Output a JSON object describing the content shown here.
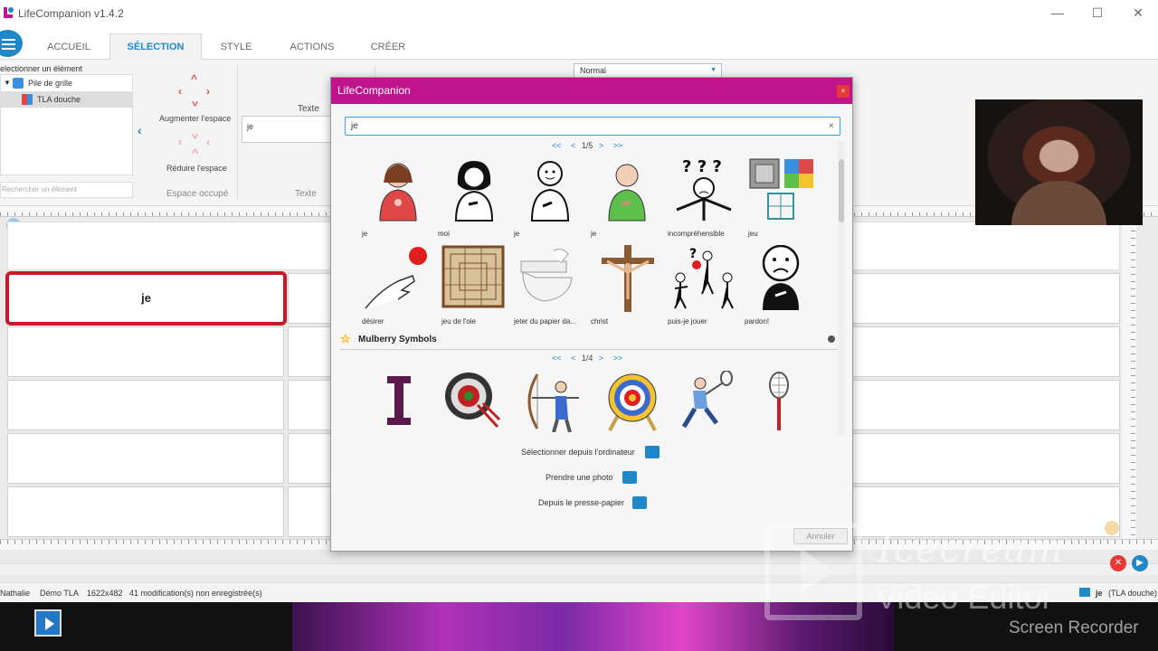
{
  "window": {
    "title": "LifeCompanion v1.4.2",
    "minimize": "—",
    "maximize": "☐",
    "close": "✕"
  },
  "tabs": [
    {
      "label": "ACCUEIL"
    },
    {
      "label": "SÉLECTION"
    },
    {
      "label": "STYLE"
    },
    {
      "label": "ACTIONS"
    },
    {
      "label": "CRÉER"
    }
  ],
  "ribbon": {
    "select_label": "electionner un élément",
    "tree": [
      {
        "label": "Pile de grille"
      },
      {
        "label": "TLA douche"
      }
    ],
    "search_placeholder": "Rechercher un élément",
    "increase_label": "Augmenter l'espace",
    "reduce_label": "Réduire l'espace",
    "group_space": "Espace occupé",
    "texte_header": "Texte",
    "texte_value": "je",
    "texte_group": "Texte",
    "style_select": "Normal"
  },
  "editor": {
    "selected_cell_text": "je"
  },
  "status": {
    "user": "Nathalie",
    "profile": "Démo TLA",
    "resolution": "1622x482",
    "changes": "41 modification(s) non enregistrée(s)",
    "current": "je",
    "current_sub": "(TLA douche)"
  },
  "dialog": {
    "title": "LifeCompanion",
    "close": "×",
    "search_value": "je",
    "clear": "×",
    "pager1": {
      "first": "<<",
      "prev": "<",
      "page": "1/5",
      "next": ">",
      "last": ">>"
    },
    "results": [
      {
        "label": "je",
        "icon": "girl-pointing-self-icon"
      },
      {
        "label": "moi",
        "icon": "woman-pointing-self-icon"
      },
      {
        "label": "je",
        "icon": "stick-person-pointing-self-icon"
      },
      {
        "label": "je",
        "icon": "man-pointing-self-icon"
      },
      {
        "label": "incompréhensible",
        "icon": "confused-person-icon"
      },
      {
        "label": "jeu",
        "icon": "board-games-icon"
      },
      {
        "label": "désirer",
        "icon": "hand-reaching-ball-icon"
      },
      {
        "label": "jeu de l'oie",
        "icon": "goose-game-board-icon"
      },
      {
        "label": "jeter du papier da...",
        "icon": "toilet-paper-icon"
      },
      {
        "label": "christ",
        "icon": "crucifix-icon"
      },
      {
        "label": "puis-je jouer",
        "icon": "may-i-play-icon"
      },
      {
        "label": "pardon!",
        "icon": "sorry-face-icon"
      }
    ],
    "section_name": "Mulberry Symbols",
    "pager2": {
      "first": "<<",
      "prev": "<",
      "page": "1/4",
      "next": ">",
      "last": ">>"
    },
    "mulberry": [
      {
        "icon": "letter-i-icon"
      },
      {
        "icon": "darts-icon"
      },
      {
        "icon": "archery-icon"
      },
      {
        "icon": "target-icon"
      },
      {
        "icon": "badminton-player-icon"
      },
      {
        "icon": "badminton-racket-icon"
      }
    ],
    "from_computer": "Sélectionner depuis l'ordinateur",
    "take_photo": "Prendre une photo",
    "from_clipboard": "Depuis le presse-papier",
    "cancel": "Annuler"
  },
  "watermark": {
    "line1": "Icecream",
    "line2": "Video Editor",
    "line3": "Screen Recorder"
  },
  "colors": {
    "accent": "#1e88c9",
    "dialog_title": "#c0148c",
    "selected_cell": "#c8192b"
  }
}
